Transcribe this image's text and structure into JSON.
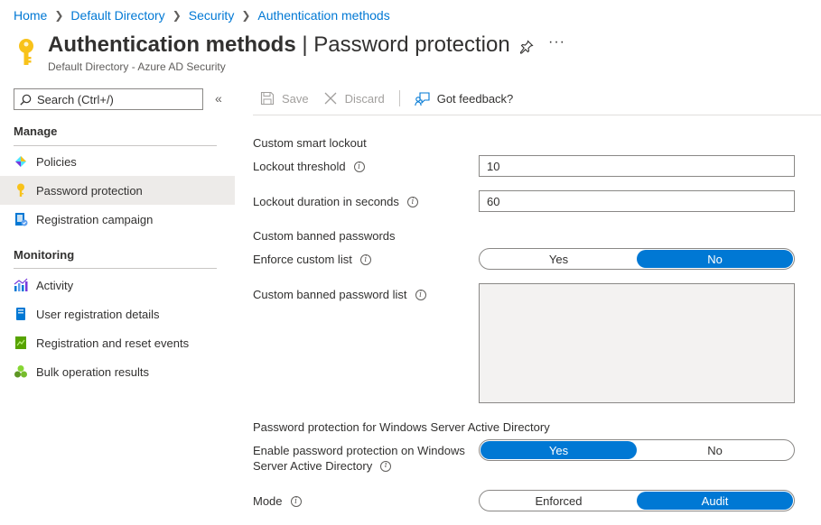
{
  "breadcrumb": [
    "Home",
    "Default Directory",
    "Security",
    "Authentication methods"
  ],
  "header": {
    "title_main": "Authentication methods",
    "title_sep": " | ",
    "title_sub": "Password protection",
    "subtitle": "Default Directory - Azure AD Security",
    "more": "···"
  },
  "sidebar": {
    "search_placeholder": "Search (Ctrl+/)",
    "collapse": "«",
    "manage_title": "Manage",
    "manage_items": [
      {
        "label": "Policies",
        "icon": "policies-icon"
      },
      {
        "label": "Password protection",
        "icon": "key-icon",
        "active": true
      },
      {
        "label": "Registration campaign",
        "icon": "registration-campaign-icon"
      }
    ],
    "monitoring_title": "Monitoring",
    "monitoring_items": [
      {
        "label": "Activity",
        "icon": "activity-chart-icon"
      },
      {
        "label": "User registration details",
        "icon": "user-details-icon"
      },
      {
        "label": "Registration and reset events",
        "icon": "events-icon"
      },
      {
        "label": "Bulk operation results",
        "icon": "bulk-results-icon"
      }
    ]
  },
  "toolbar": {
    "save": "Save",
    "discard": "Discard",
    "feedback": "Got feedback?"
  },
  "form": {
    "lockout_title": "Custom smart lockout",
    "lockout_threshold_label": "Lockout threshold",
    "lockout_threshold_value": "10",
    "lockout_duration_label": "Lockout duration in seconds",
    "lockout_duration_value": "60",
    "banned_title": "Custom banned passwords",
    "enforce_label": "Enforce custom list",
    "enforce_options": [
      "Yes",
      "No"
    ],
    "enforce_selected": "No",
    "banned_list_label": "Custom banned password list",
    "banned_list_value": "",
    "ad_title": "Password protection for Windows Server Active Directory",
    "ad_enable_label_1": "Enable password protection on Windows",
    "ad_enable_label_2": "Server Active Directory",
    "ad_enable_options": [
      "Yes",
      "No"
    ],
    "ad_enable_selected": "Yes",
    "mode_label": "Mode",
    "mode_options": [
      "Enforced",
      "Audit"
    ],
    "mode_selected": "Audit"
  },
  "colors": {
    "accent": "#0078d4",
    "key_yellow": "#f8c21a",
    "active_bg": "#edebe9"
  }
}
